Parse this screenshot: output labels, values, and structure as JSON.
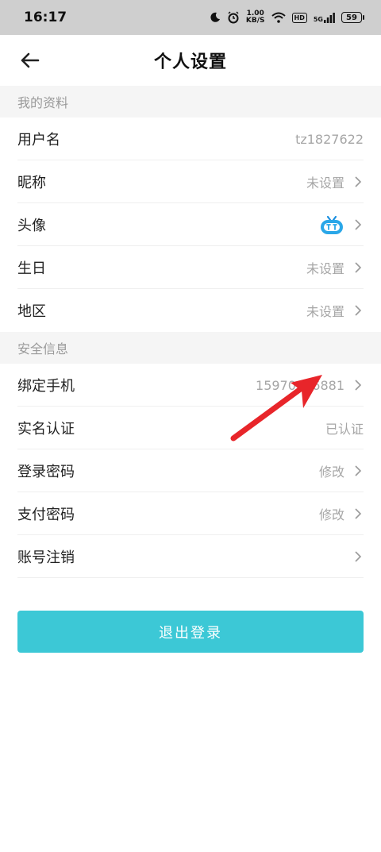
{
  "status_bar": {
    "time": "16:17",
    "speed_value": "1.00",
    "speed_unit": "KB/S",
    "hd": "HD",
    "network": "5G",
    "battery": "59"
  },
  "header": {
    "title": "个人设置"
  },
  "profile": {
    "section_title": "我的资料",
    "items": [
      {
        "label": "用户名",
        "value": "tz1827622"
      },
      {
        "label": "昵称",
        "value": "未设置"
      },
      {
        "label": "头像",
        "value": ""
      },
      {
        "label": "生日",
        "value": "未设置"
      },
      {
        "label": "地区",
        "value": "未设置"
      }
    ]
  },
  "security": {
    "section_title": "安全信息",
    "items": [
      {
        "label": "绑定手机",
        "value": "15970036881"
      },
      {
        "label": "实名认证",
        "value": "已认证"
      },
      {
        "label": "登录密码",
        "value": "修改"
      },
      {
        "label": "支付密码",
        "value": "修改"
      },
      {
        "label": "账号注销",
        "value": ""
      }
    ]
  },
  "logout_label": "退出登录",
  "colors": {
    "accent": "#3cc8d6",
    "annotation_arrow": "#e8252a",
    "section_bg": "#f5f5f5"
  }
}
